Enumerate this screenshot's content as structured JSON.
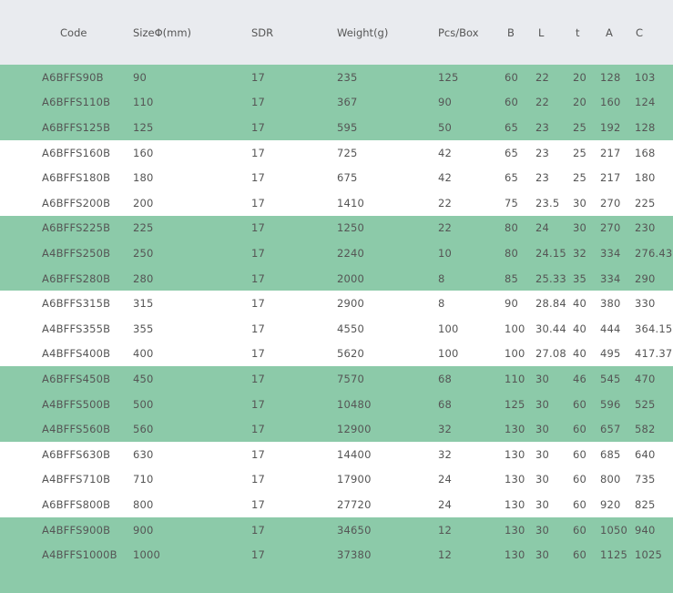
{
  "table": {
    "headers": [
      "Code",
      "SizeΦ(mm)",
      "SDR",
      "Weight(g)",
      "Pcs/Box",
      "B",
      "L",
      "t",
      "A",
      "C"
    ],
    "rows": [
      [
        "A6BFFS90B",
        "90",
        "17",
        "235",
        "125",
        "60",
        "22",
        "20",
        "128",
        "103"
      ],
      [
        "A6BFFS110B",
        "110",
        "17",
        "367",
        "90",
        "60",
        "22",
        "20",
        "160",
        "124"
      ],
      [
        "A6BFFS125B",
        "125",
        "17",
        "595",
        "50",
        "65",
        "23",
        "25",
        "192",
        "128"
      ],
      [
        "A6BFFS160B",
        "160",
        "17",
        "725",
        "42",
        "65",
        "23",
        "25",
        "217",
        "168"
      ],
      [
        "A6BFFS180B",
        "180",
        "17",
        "675",
        "42",
        "65",
        "23",
        "25",
        "217",
        "180"
      ],
      [
        "A6BFFS200B",
        "200",
        "17",
        "1410",
        "22",
        "75",
        "23.5",
        "30",
        "270",
        "225"
      ],
      [
        "A6BFFS225B",
        "225",
        "17",
        "1250",
        "22",
        "80",
        "24",
        "30",
        "270",
        "230"
      ],
      [
        "A4BFFS250B",
        "250",
        "17",
        "2240",
        "10",
        "80",
        "24.15",
        "32",
        "334",
        "276.43"
      ],
      [
        "A6BFFS280B",
        "280",
        "17",
        "2000",
        "8",
        "85",
        "25.33",
        "35",
        "334",
        "290"
      ],
      [
        "A6BFFS315B",
        "315",
        "17",
        "2900",
        "8",
        "90",
        "28.84",
        "40",
        "380",
        "330"
      ],
      [
        "A4BFFS355B",
        "355",
        "17",
        "4550",
        "100",
        "100",
        "30.44",
        "40",
        "444",
        "364.15"
      ],
      [
        "A4BFFS400B",
        "400",
        "17",
        "5620",
        "100",
        "100",
        "27.08",
        "40",
        "495",
        "417.37"
      ],
      [
        "A6BFFS450B",
        "450",
        "17",
        "7570",
        "68",
        "110",
        "30",
        "46",
        "545",
        "470"
      ],
      [
        "A4BFFS500B",
        "500",
        "17",
        "10480",
        "68",
        "125",
        "30",
        "60",
        "596",
        "525"
      ],
      [
        "A4BFFS560B",
        "560",
        "17",
        "12900",
        "32",
        "130",
        "30",
        "60",
        "657",
        "582"
      ],
      [
        "A6BFFS630B",
        "630",
        "17",
        "14400",
        "32",
        "130",
        "30",
        "60",
        "685",
        "640"
      ],
      [
        "A4BFFS710B",
        "710",
        "17",
        "17900",
        "24",
        "130",
        "30",
        "60",
        "800",
        "735"
      ],
      [
        "A6BFFS800B",
        "800",
        "17",
        "27720",
        "24",
        "130",
        "30",
        "60",
        "920",
        "825"
      ],
      [
        "A4BFFS900B",
        "900",
        "17",
        "34650",
        "12",
        "130",
        "30",
        "60",
        "1050",
        "940"
      ],
      [
        "A4BFFS1000B",
        "1000",
        "17",
        "37380",
        "12",
        "130",
        "30",
        "60",
        "1125",
        "1025"
      ]
    ]
  },
  "colors": {
    "header_bg": "#e9ebef",
    "band_green": "#8ccaa9",
    "band_white": "#ffffff",
    "text": "#555555"
  }
}
